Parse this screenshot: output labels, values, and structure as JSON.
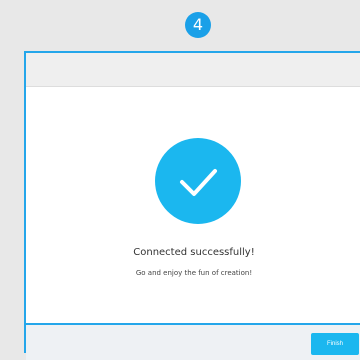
{
  "step": {
    "number": "4"
  },
  "dialog": {
    "icon": "check-icon",
    "title": "Connected successfully!",
    "subtitle": "Go and enjoy the fun of creation!",
    "finish_label": "Finish"
  },
  "colors": {
    "accent": "#1bb7ef",
    "border": "#24a6ea",
    "background": "#e8e8e8"
  }
}
